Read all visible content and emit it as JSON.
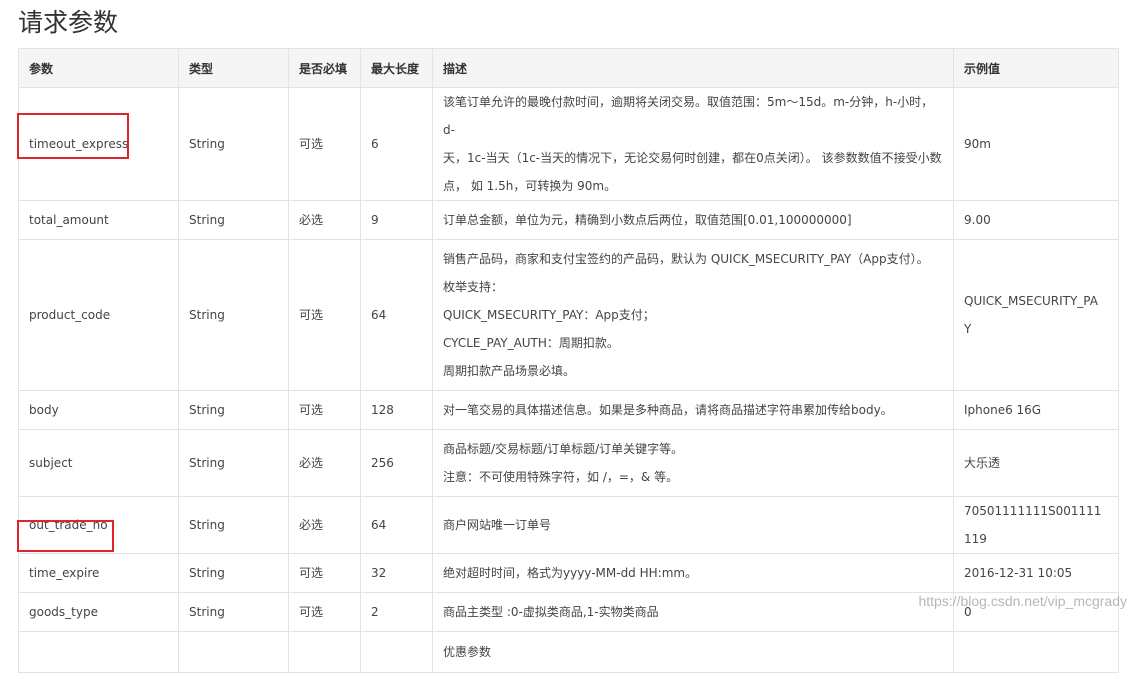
{
  "title": "请求参数",
  "headers": [
    "参数",
    "类型",
    "是否必填",
    "最大长度",
    "描述",
    "示例值"
  ],
  "rows": [
    {
      "param": "timeout_express",
      "type": "String",
      "required": "可选",
      "maxlen": "6",
      "desc": [
        "该笔订单允许的最晚付款时间，逾期将关闭交易。取值范围：5m～15d。m-分钟，h-小时，d-",
        "天，1c-当天（1c-当天的情况下，无论交易何时创建，都在0点关闭）。 该参数数值不接受小数",
        "点， 如 1.5h，可转换为 90m。"
      ],
      "example": "90m"
    },
    {
      "param": "total_amount",
      "type": "String",
      "required": "必选",
      "maxlen": "9",
      "desc": [
        "订单总金额，单位为元，精确到小数点后两位，取值范围[0.01,100000000]"
      ],
      "example": "9.00"
    },
    {
      "param": "product_code",
      "type": "String",
      "required": "可选",
      "maxlen": "64",
      "desc": [
        "销售产品码，商家和支付宝签约的产品码，默认为 QUICK_MSECURITY_PAY（App支付）。",
        "枚举支持：",
        "QUICK_MSECURITY_PAY：App支付；",
        "CYCLE_PAY_AUTH：周期扣款。",
        "周期扣款产品场景必填。"
      ],
      "example": [
        "QUICK_MSECURITY_PA",
        "Y"
      ]
    },
    {
      "param": "body",
      "type": "String",
      "required": "可选",
      "maxlen": "128",
      "desc": [
        "对一笔交易的具体描述信息。如果是多种商品，请将商品描述字符串累加传给body。"
      ],
      "example": "Iphone6 16G"
    },
    {
      "param": "subject",
      "type": "String",
      "required": "必选",
      "maxlen": "256",
      "desc": [
        "商品标题/交易标题/订单标题/订单关键字等。",
        "注意：不可使用特殊字符，如 /，=，& 等。"
      ],
      "example": "大乐透"
    },
    {
      "param": "out_trade_no",
      "type": "String",
      "required": "必选",
      "maxlen": "64",
      "desc": [
        "商户网站唯一订单号"
      ],
      "example": "70501111111S001111119"
    },
    {
      "param": "time_expire",
      "type": "String",
      "required": "可选",
      "maxlen": "32",
      "desc": [
        "绝对超时时间，格式为yyyy-MM-dd HH:mm。"
      ],
      "example": "2016-12-31 10:05"
    },
    {
      "param": "goods_type",
      "type": "String",
      "required": "可选",
      "maxlen": "2",
      "desc": [
        "商品主类型 :0-虚拟类商品,1-实物类商品"
      ],
      "example": "0"
    },
    {
      "param": "",
      "type": "",
      "required": "",
      "maxlen": "",
      "desc": [
        "优惠参数"
      ],
      "example": ""
    }
  ],
  "watermark": "https://blog.csdn.net/vip_mcgrady",
  "colors": {
    "highlight": "#e0242b",
    "header_bg": "#f5f5f5",
    "border": "#e3e3e3"
  }
}
